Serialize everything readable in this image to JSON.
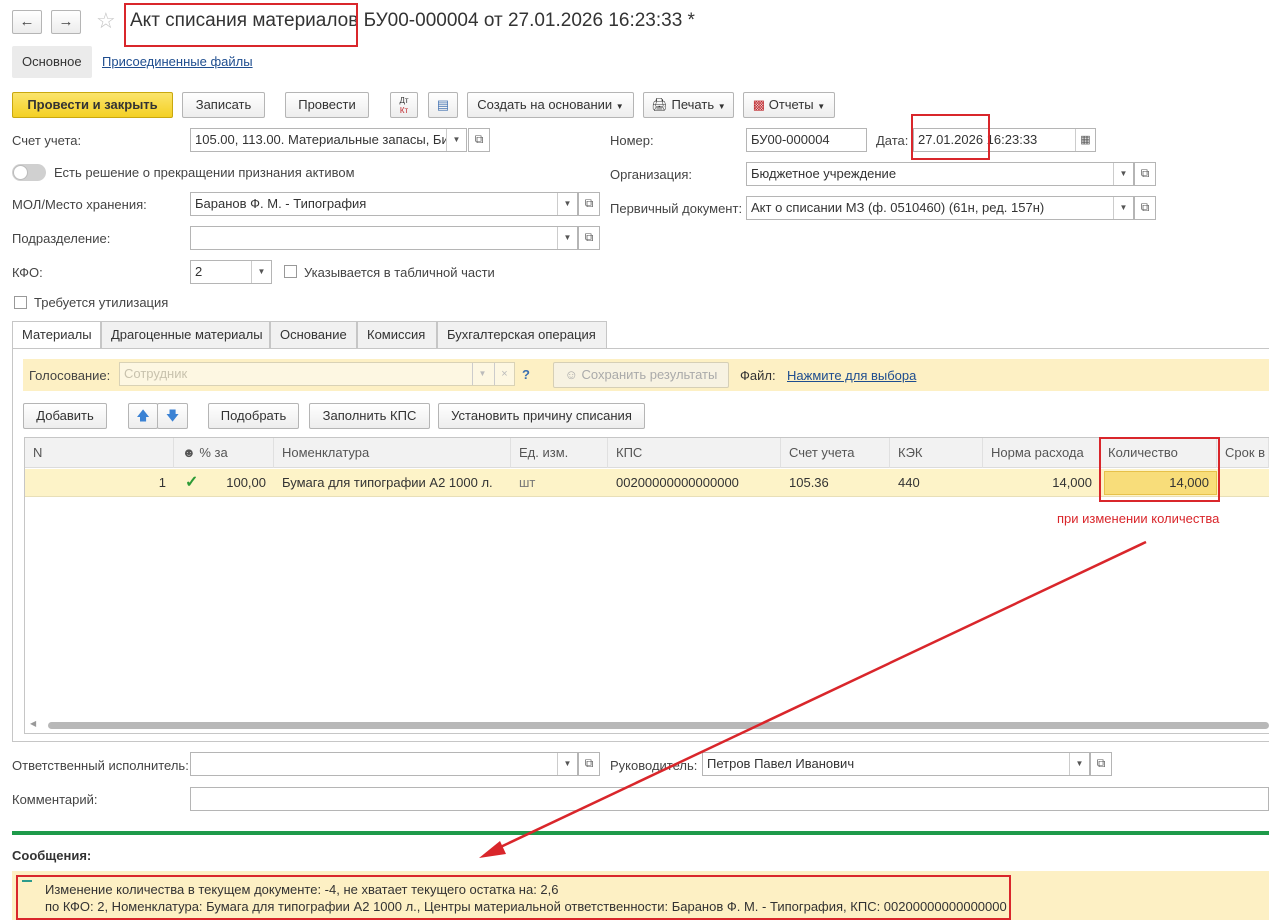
{
  "window": {
    "title": "Акт списания материалов БУ00-000004 от 27.01.2026 16:23:33 *",
    "tabs": [
      "Основное",
      "Присоединенные файлы"
    ]
  },
  "toolbar": {
    "post_close": "Провести и закрыть",
    "save": "Записать",
    "post": "Провести",
    "dtkt_top": "Дт",
    "dtkt_bottom": "Кт",
    "create_based": "Создать на основании",
    "print": "Печать",
    "reports": "Отчеты"
  },
  "form": {
    "account_label": "Счет учета:",
    "account_value": "105.00, 113.00. Материальные запасы, Би",
    "decision_label": "Есть решение о прекращении признания активом",
    "mol_label": "МОЛ/Место хранения:",
    "mol_value": "Баранов Ф. М. - Типография",
    "division_label": "Подразделение:",
    "division_value": "",
    "kfo_label": "КФО:",
    "kfo_value": "2",
    "kfo_in_table_label": "Указывается в табличной части",
    "utilization_label": "Требуется утилизация",
    "number_label": "Номер:",
    "number_value": "БУ00-000004",
    "date_label": "Дата:",
    "date_value": "27.01.2026 16:23:33",
    "org_label": "Организация:",
    "org_value": "Бюджетное учреждение",
    "primary_doc_label": "Первичный документ:",
    "primary_doc_value": "Акт о списании МЗ (ф. 0510460) (61н, ред. 157н)"
  },
  "tabs": [
    "Материалы",
    "Драгоценные материалы",
    "Основание",
    "Комиссия",
    "Бухгалтерская операция"
  ],
  "voting": {
    "label": "Голосование:",
    "placeholder": "Сотрудник",
    "help": "?",
    "save_results": "Сохранить результаты",
    "file_label": "Файл:",
    "file_link": "Нажмите для выбора"
  },
  "table_toolbar": {
    "add": "Добавить",
    "pick": "Подобрать",
    "fill_kps": "Заполнить КПС",
    "set_reason": "Установить причину списания"
  },
  "table": {
    "columns": [
      "N",
      "% за",
      "Номенклатура",
      "Ед. изм.",
      "КПС",
      "Счет учета",
      "КЭК",
      "Норма расхода",
      "Количество",
      "Срок в"
    ],
    "rows": [
      {
        "n": "1",
        "percent": "100,00",
        "nomenclature": "Бумага для типографии А2 1000 л.",
        "unit": "шт",
        "kps": "00200000000000000",
        "account": "105.36",
        "kek": "440",
        "norm": "14,000",
        "qty": "14,000"
      }
    ]
  },
  "annotation": "при изменении количества",
  "bottom": {
    "responsible_label": "Ответственный исполнитель:",
    "responsible_value": "",
    "head_label": "Руководитель:",
    "head_value": "Петров Павел Иванович",
    "comment_label": "Комментарий:",
    "comment_value": ""
  },
  "messages": {
    "title": "Сообщения:",
    "line1": "Изменение количества в текущем документе: -4, не хватает текущего остатка на: 2,6",
    "line2": "по КФО: 2, Номенклатура: Бумага для типографии А2 1000 л., Центры материальной ответственности: Баранов Ф. М. - Типография, КПС: 00200000000000000"
  },
  "colors": {
    "primary_button": "#f4d024",
    "highlight_row": "#fdf3c8",
    "voting_panel": "#fdf0c4",
    "separator": "#1e9a4a",
    "annotation_red": "#d9262b"
  }
}
